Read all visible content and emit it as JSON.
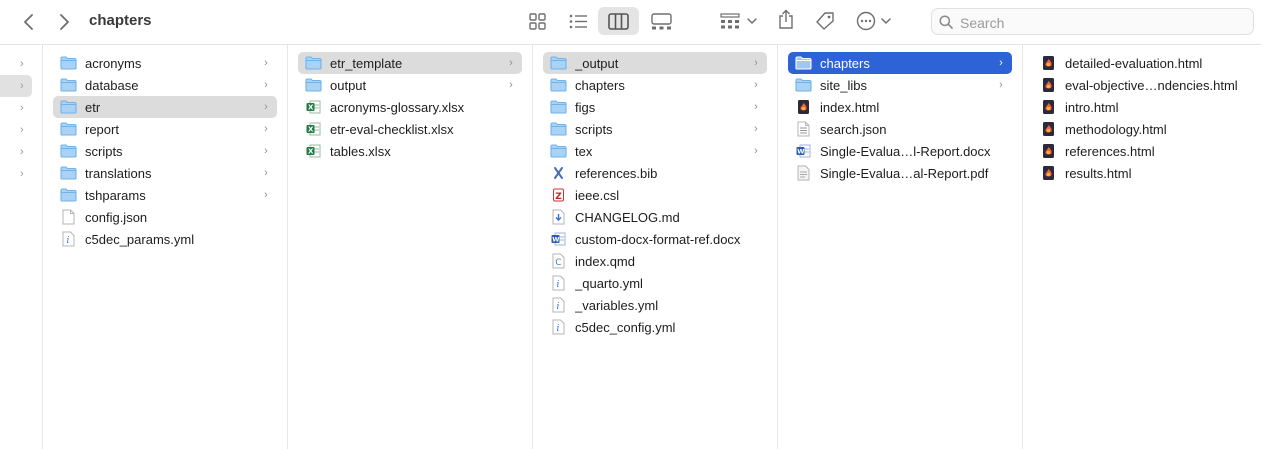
{
  "window": {
    "title": "chapters"
  },
  "search": {
    "placeholder": "Search"
  },
  "toolbar": {
    "icons": [
      "back-chevron-icon",
      "forward-chevron-icon",
      "icon-view-icon",
      "list-view-icon",
      "column-view-icon",
      "gallery-view-icon",
      "group-icon",
      "share-icon",
      "tag-icon",
      "more-actions-icon",
      "search-icon"
    ],
    "active_view": "column-view"
  },
  "colors": {
    "folder": "#6fb3ea",
    "selection_blue": "#2d63d6",
    "selection_gray": "#dcdcdc"
  },
  "columns": [
    {
      "items": [
        {
          "label": "acronyms",
          "kind": "folder",
          "chevron": true
        },
        {
          "label": "database",
          "kind": "folder",
          "chevron": true
        },
        {
          "label": "etr",
          "kind": "folder",
          "chevron": true,
          "selected": "gray"
        },
        {
          "label": "report",
          "kind": "folder",
          "chevron": true
        },
        {
          "label": "scripts",
          "kind": "folder",
          "chevron": true
        },
        {
          "label": "translations",
          "kind": "folder",
          "chevron": true
        },
        {
          "label": "tshparams",
          "kind": "folder",
          "chevron": true
        },
        {
          "label": "config.json",
          "kind": "doc"
        },
        {
          "label": "c5dec_params.yml",
          "kind": "yml"
        }
      ]
    },
    {
      "items": [
        {
          "label": "etr_template",
          "kind": "folder",
          "chevron": true,
          "selected": "gray"
        },
        {
          "label": "output",
          "kind": "folder",
          "chevron": true
        },
        {
          "label": "acronyms-glossary.xlsx",
          "kind": "xlsx"
        },
        {
          "label": "etr-eval-checklist.xlsx",
          "kind": "xlsx"
        },
        {
          "label": "tables.xlsx",
          "kind": "xlsx"
        }
      ]
    },
    {
      "items": [
        {
          "label": "_output",
          "kind": "folder",
          "chevron": true,
          "selected": "gray"
        },
        {
          "label": "chapters",
          "kind": "folder",
          "chevron": true
        },
        {
          "label": "figs",
          "kind": "folder",
          "chevron": true
        },
        {
          "label": "scripts",
          "kind": "folder",
          "chevron": true
        },
        {
          "label": "tex",
          "kind": "folder",
          "chevron": true
        },
        {
          "label": "references.bib",
          "kind": "bib"
        },
        {
          "label": "ieee.csl",
          "kind": "csl"
        },
        {
          "label": "CHANGELOG.md",
          "kind": "md"
        },
        {
          "label": "custom-docx-format-ref.docx",
          "kind": "docx"
        },
        {
          "label": "index.qmd",
          "kind": "qmd"
        },
        {
          "label": "_quarto.yml",
          "kind": "yml"
        },
        {
          "label": "_variables.yml",
          "kind": "yml"
        },
        {
          "label": "c5dec_config.yml",
          "kind": "yml"
        }
      ]
    },
    {
      "items": [
        {
          "label": "chapters",
          "kind": "folder",
          "chevron": true,
          "selected": "blue"
        },
        {
          "label": "site_libs",
          "kind": "folder",
          "chevron": true
        },
        {
          "label": "index.html",
          "kind": "html"
        },
        {
          "label": "search.json",
          "kind": "json"
        },
        {
          "label": "Single-Evalua…l-Report.docx",
          "kind": "docx"
        },
        {
          "label": "Single-Evalua…al-Report.pdf",
          "kind": "pdf"
        }
      ]
    },
    {
      "items": [
        {
          "label": "detailed-evaluation.html",
          "kind": "html"
        },
        {
          "label": "eval-objective…ndencies.html",
          "kind": "html"
        },
        {
          "label": "intro.html",
          "kind": "html"
        },
        {
          "label": "methodology.html",
          "kind": "html"
        },
        {
          "label": "references.html",
          "kind": "html"
        },
        {
          "label": "results.html",
          "kind": "html"
        }
      ]
    }
  ]
}
